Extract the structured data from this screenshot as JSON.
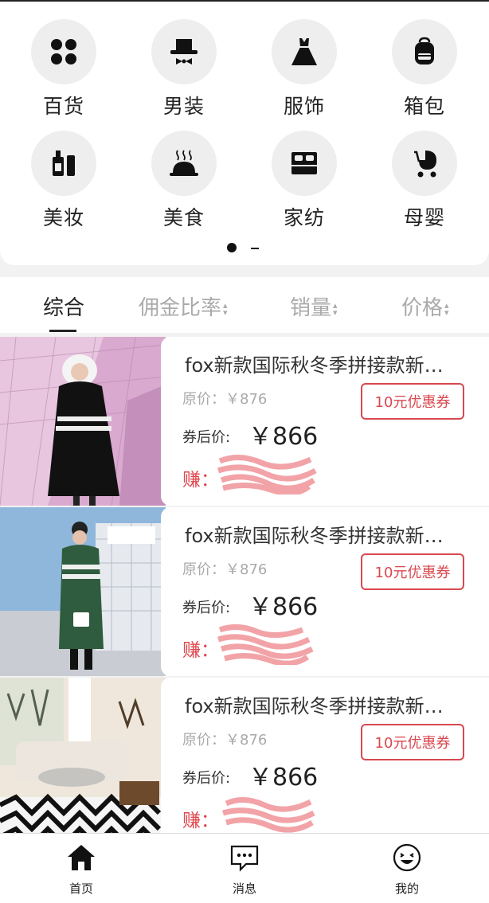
{
  "categories": [
    {
      "label": "百货",
      "icon": "four-dots-icon"
    },
    {
      "label": "男装",
      "icon": "top-hat-bowtie-icon"
    },
    {
      "label": "服饰",
      "icon": "dress-icon"
    },
    {
      "label": "箱包",
      "icon": "backpack-icon"
    },
    {
      "label": "美妆",
      "icon": "cosmetics-bottle-icon"
    },
    {
      "label": "美食",
      "icon": "food-cloche-icon"
    },
    {
      "label": "家纺",
      "icon": "bed-icon"
    },
    {
      "label": "母婴",
      "icon": "baby-stroller-icon"
    }
  ],
  "sort": {
    "tabs": [
      "综合",
      "佣金比率",
      "销量",
      "价格"
    ],
    "active": "综合"
  },
  "products": [
    {
      "title": "fox新款国际秋冬季拼接款新…",
      "orig_label": "原价：",
      "orig_price": "￥876",
      "coupon": "10元优惠券",
      "after_label": "券后价:",
      "after_price": "￥866",
      "earn_label": "赚："
    },
    {
      "title": "fox新款国际秋冬季拼接款新…",
      "orig_label": "原价：",
      "orig_price": "￥876",
      "coupon": "10元优惠券",
      "after_label": "券后价:",
      "after_price": "￥866",
      "earn_label": "赚："
    },
    {
      "title": "fox新款国际秋冬季拼接款新…",
      "orig_label": "原价：",
      "orig_price": "￥876",
      "coupon": "10元优惠券",
      "after_label": "券后价:",
      "after_price": "￥866",
      "earn_label": "赚："
    }
  ],
  "nav": [
    {
      "label": "首页",
      "icon": "home-icon"
    },
    {
      "label": "消息",
      "icon": "message-icon"
    },
    {
      "label": "我的",
      "icon": "smiley-icon"
    }
  ],
  "colors": {
    "accent_red": "#d9484f",
    "text_dark": "#222222",
    "text_muted": "#aaaaaa"
  }
}
